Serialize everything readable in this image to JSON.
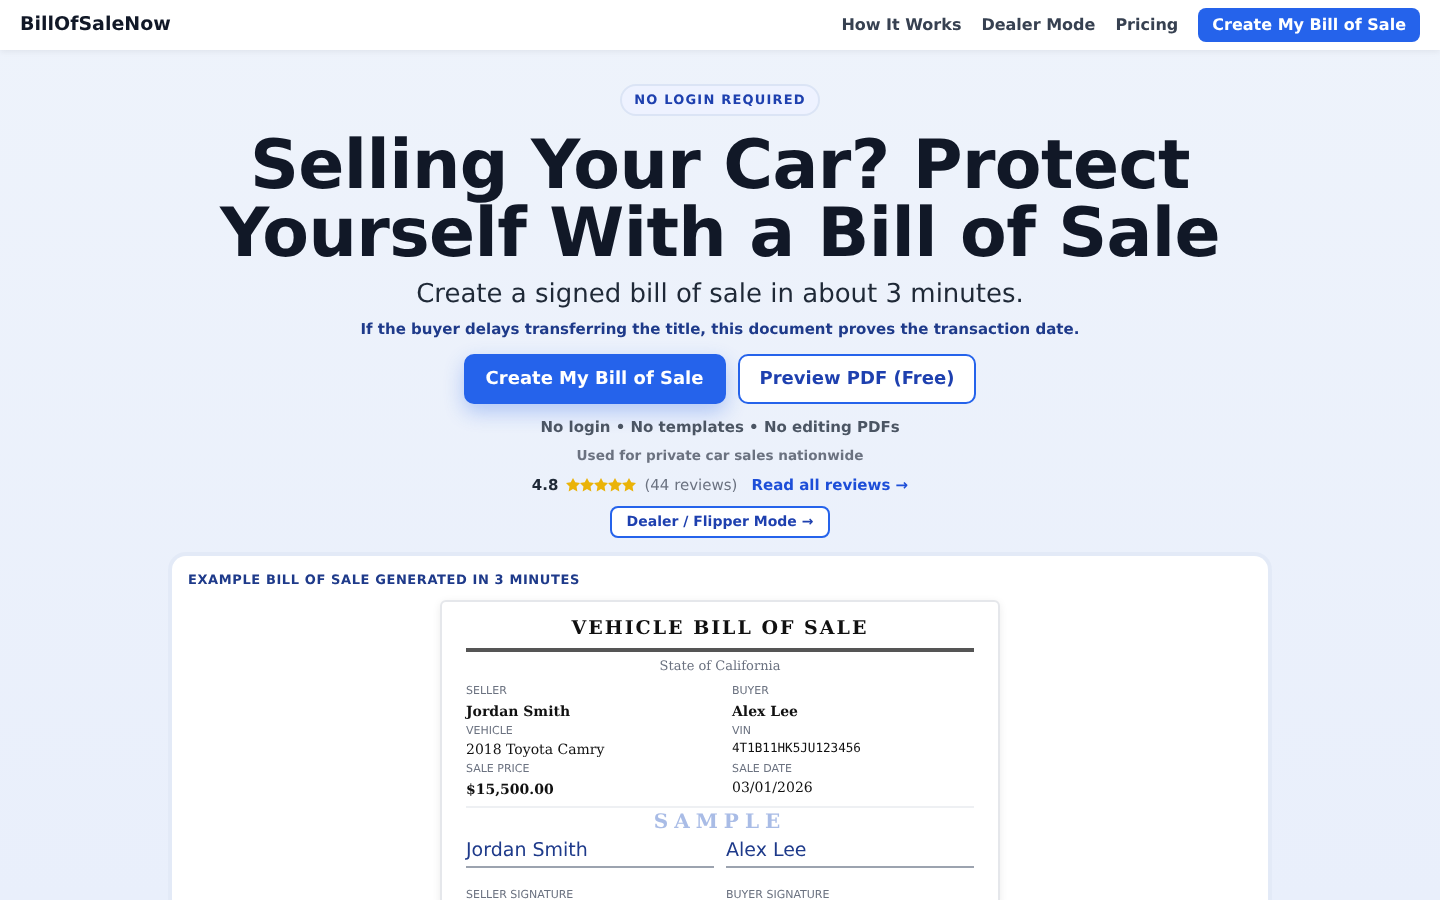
{
  "header": {
    "logo": "BillOfSaleNow",
    "nav": [
      "How It Works",
      "Dealer Mode",
      "Pricing"
    ],
    "cta": "Create My Bill of Sale"
  },
  "hero": {
    "badge": "NO LOGIN REQUIRED",
    "title_lines": [
      "Selling Your Car? Protect",
      "Yourself With a Bill of Sale"
    ],
    "subtitle": "Create a signed bill of sale in about 3 minutes.",
    "note": "If the buyer delays transferring the title, this document proves the transaction date.",
    "buttons": [
      {
        "label": "Create My Bill of Sale",
        "kind": "primary"
      },
      {
        "label": "Preview PDF (Free)",
        "kind": "outline"
      }
    ],
    "features": "No login • No templates • No editing PDFs",
    "usage": "Used for private car sales nationwide",
    "rating": {
      "score": "4.8",
      "stars": 5,
      "reviews": "(44 reviews)",
      "link": "Read all reviews →"
    },
    "dealer_button": "Dealer / Flipper Mode →"
  },
  "example": {
    "heading": "EXAMPLE BILL OF SALE GENERATED IN 3 MINUTES",
    "document": {
      "title": "VEHICLE BILL OF SALE",
      "state": "State of California",
      "watermark": "SAMPLE",
      "fields": [
        {
          "label": "SELLER",
          "value": "Jordan Smith",
          "kind": "bold"
        },
        {
          "label": "BUYER",
          "value": "Alex Lee",
          "kind": "bold"
        },
        {
          "label": "VEHICLE",
          "value": "2018 Toyota Camry",
          "kind": "plain"
        },
        {
          "label": "VIN",
          "value": "4T1B11HK5JU123456",
          "kind": "mono"
        },
        {
          "label": "SALE PRICE",
          "value": "$15,500.00",
          "kind": "bold"
        },
        {
          "label": "SALE DATE",
          "value": "03/01/2026",
          "kind": "plain"
        }
      ],
      "signatures": [
        {
          "name": "Jordan Smith",
          "label": "SELLER SIGNATURE"
        },
        {
          "name": "Alex Lee",
          "label": "BUYER SIGNATURE"
        }
      ]
    }
  }
}
